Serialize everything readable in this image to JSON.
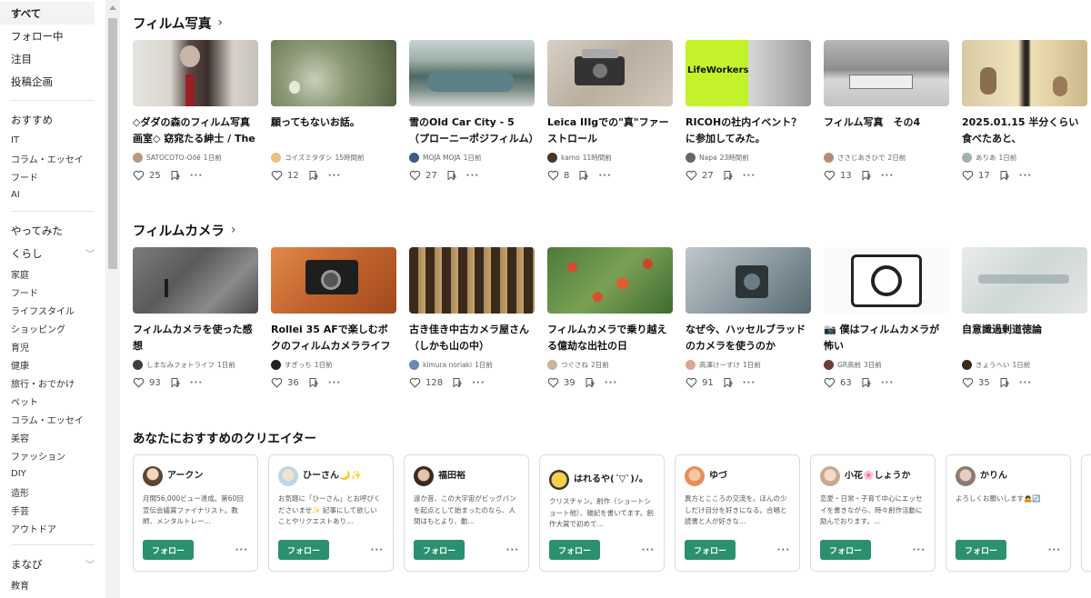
{
  "sidebar": {
    "top": [
      {
        "label": "すべて",
        "active": true
      },
      {
        "label": "フォロー中"
      },
      {
        "label": "注目"
      },
      {
        "label": "投稿企画"
      }
    ],
    "osusume": {
      "label": "おすすめ",
      "items": [
        "IT",
        "コラム・エッセイ",
        "フード",
        "AI"
      ]
    },
    "yattemita": {
      "label": "やってみた"
    },
    "kurashi": {
      "label": "くらし",
      "items": [
        "家庭",
        "フード",
        "ライフスタイル",
        "ショッピング",
        "育児",
        "健康",
        "旅行・おでかけ",
        "ペット",
        "コラム・エッセイ",
        "美容",
        "ファッション",
        "DIY",
        "造形",
        "手芸",
        "アウトドア"
      ]
    },
    "manabi": {
      "label": "まなび",
      "items": [
        "教育"
      ]
    }
  },
  "sections": [
    {
      "title": "フィルム写真",
      "cards": [
        {
          "title": "◇ダダの森のフィルム写真画室◇ 窈窕たる紳士 / The Classy Gentleman....",
          "author": "SATOCOTO-Oōē",
          "time": "1日前",
          "likes": "25",
          "likes_shown": true
        },
        {
          "title": "願ってもないお話。",
          "author": "コイズミタダシ",
          "time": "15時間前",
          "likes": "12",
          "likes_shown": true
        },
        {
          "title": "雪のOld Car City - 5 （プローニーポジフィルム）",
          "author": "MOJA MOJA",
          "time": "1日前",
          "likes": "27",
          "likes_shown": true
        },
        {
          "title": "Leica IIIgでの\"真\"ファーストロール",
          "author": "kamo",
          "time": "11時間前",
          "likes": "8",
          "likes_shown": true
        },
        {
          "title": "RICOHの社内イベント？に参加してみた。",
          "author": "Napa",
          "time": "23時間前",
          "likes": "27",
          "likes_shown": true
        },
        {
          "title": "フィルム写真　その4",
          "author": "ささじあきひで",
          "time": "2日前",
          "likes": "13",
          "likes_shown": true
        },
        {
          "title": "2025.01.15 半分くらい食べたあと、",
          "author": "ありあ",
          "time": "1日前",
          "likes": "17",
          "likes_shown": true
        }
      ]
    },
    {
      "title": "フィルムカメラ",
      "cards": [
        {
          "title": "フィルムカメラを使った感想",
          "author": "しまなみフォトライフ",
          "time": "1日前",
          "likes": "93",
          "likes_shown": true
        },
        {
          "title": "Rollei 35 AFで楽しむボクのフィルムカメラライフ",
          "author": "すぎっち",
          "time": "1日前",
          "likes": "36",
          "likes_shown": true
        },
        {
          "title": "古き佳き中古カメラ屋さん（しかも山の中）",
          "author": "kimura noriaki",
          "time": "1日前",
          "likes": "128",
          "likes_shown": true
        },
        {
          "title": "フィルムカメラで乗り越える億劫な出社の日",
          "author": "つぐさね",
          "time": "2日前",
          "likes": "39",
          "likes_shown": true
        },
        {
          "title": "なぜ今、ハッセルブラッドのカメラを使うのか",
          "author": "高澤けーすけ",
          "time": "1日前",
          "likes": "91",
          "likes_shown": true
        },
        {
          "title": "📷 僕はフィルムカメラが怖い",
          "author": "GR高前",
          "time": "3日前",
          "likes": "63",
          "likes_shown": true
        },
        {
          "title": "自意識過剰道徳論",
          "author": "きょうへい",
          "time": "1日前",
          "likes": "35",
          "likes_shown": true
        }
      ]
    }
  ],
  "creators": {
    "title": "あなたにおすすめのクリエイター",
    "follow_label": "フォロー",
    "items": [
      {
        "name": "アークン",
        "bio": "月間56,000ビュー達成。第60回宣伝会議賞ファイナリスト。教師、メンタルトレー…"
      },
      {
        "name": "ひーさん🌙✨",
        "bio": "お気軽に「ひーさん」とお呼びくださいませ✨ 記事にして欲しいことやリクエストあり…"
      },
      {
        "name": "福田裕",
        "bio": "遠か昔、この大宇宙がビッグバンを起点として始まったのなら、人間はもとより、動…"
      },
      {
        "name": "はれるや(´▽`)ﾉ。",
        "bio": "クリスチャン。創作（ショートショート他）、雑記を書いてます。創作大賞で初めて…"
      },
      {
        "name": "ゆづ",
        "bio": "異方とこころの交流を。ほんの少しだけ自分を好きになる。合唱と読書と人が好きな…"
      },
      {
        "name": "小花🌸しょうか",
        "bio": "恋愛・日常・子育て中心にエッセイを書きながら、時々創作活動に励んでおります。…"
      },
      {
        "name": "かりん",
        "bio": "よろしくお願いします🙇🔄"
      }
    ]
  }
}
